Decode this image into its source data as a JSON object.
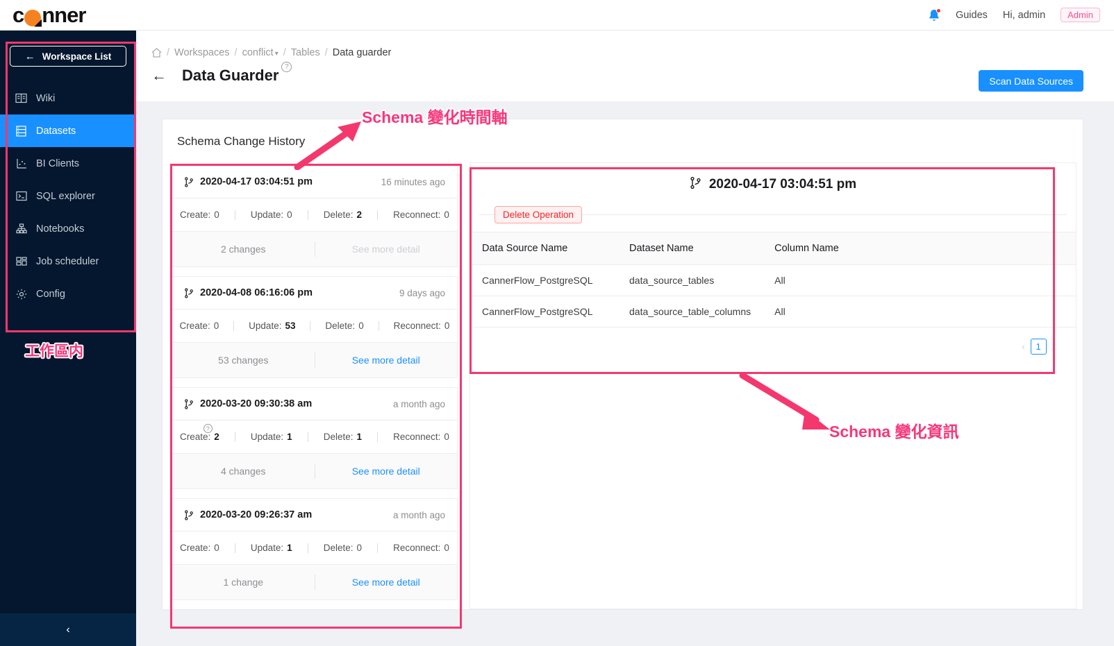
{
  "topbar": {
    "logo_text": "canner",
    "bell_icon": "bell-icon",
    "guides_label": "Guides",
    "greeting": "Hi, admin",
    "role_badge": "Admin"
  },
  "sidebar": {
    "workspace_button": "Workspace List",
    "back_arrow": "←",
    "collapse_arrow": "‹",
    "items": [
      {
        "label": "Wiki",
        "icon": "book-icon",
        "active": false
      },
      {
        "label": "Datasets",
        "icon": "database-icon",
        "active": true
      },
      {
        "label": "BI Clients",
        "icon": "chart-icon",
        "active": false
      },
      {
        "label": "SQL explorer",
        "icon": "console-icon",
        "active": false
      },
      {
        "label": "Notebooks",
        "icon": "cluster-icon",
        "active": false
      },
      {
        "label": "Job scheduler",
        "icon": "schedule-icon",
        "active": false
      },
      {
        "label": "Config",
        "icon": "gear-icon",
        "active": false
      }
    ]
  },
  "breadcrumb": {
    "home_icon": "home-icon",
    "items": [
      "Workspaces",
      "conflict",
      "Tables",
      "Data guarder"
    ],
    "separator": "/",
    "caret": "⌄"
  },
  "header": {
    "back_arrow": "←",
    "title": "Data Guarder",
    "help_icon": "?",
    "scan_button": "Scan Data Sources"
  },
  "section": {
    "title": "Schema Change History"
  },
  "timeline": {
    "branch_icon": "git-branch-icon",
    "entries": [
      {
        "date": "2020-04-17 03:04:51 pm",
        "relative": "16 minutes ago",
        "stats": [
          {
            "label": "Create:",
            "value": "0",
            "bold": false
          },
          {
            "label": "Update:",
            "value": "0",
            "bold": false
          },
          {
            "label": "Delete:",
            "value": "2",
            "bold": true
          },
          {
            "label": "Reconnect:",
            "value": "0",
            "bold": false
          }
        ],
        "changes": "2 changes",
        "more_label": "See more detail",
        "more_disabled": true,
        "has_tooltip": false
      },
      {
        "date": "2020-04-08 06:16:06 pm",
        "relative": "9 days ago",
        "stats": [
          {
            "label": "Create:",
            "value": "0",
            "bold": false
          },
          {
            "label": "Update:",
            "value": "53",
            "bold": true
          },
          {
            "label": "Delete:",
            "value": "0",
            "bold": false
          },
          {
            "label": "Reconnect:",
            "value": "0",
            "bold": false
          }
        ],
        "changes": "53 changes",
        "more_label": "See more detail",
        "more_disabled": false,
        "has_tooltip": false
      },
      {
        "date": "2020-03-20 09:30:38 am",
        "relative": "a month ago",
        "stats": [
          {
            "label": "Create:",
            "value": "2",
            "bold": true
          },
          {
            "label": "Update:",
            "value": "1",
            "bold": true
          },
          {
            "label": "Delete:",
            "value": "1",
            "bold": true
          },
          {
            "label": "Reconnect:",
            "value": "0",
            "bold": false
          }
        ],
        "changes": "4 changes",
        "more_label": "See more detail",
        "more_disabled": false,
        "has_tooltip": true
      },
      {
        "date": "2020-03-20 09:26:37 am",
        "relative": "a month ago",
        "stats": [
          {
            "label": "Create:",
            "value": "0",
            "bold": false
          },
          {
            "label": "Update:",
            "value": "1",
            "bold": true
          },
          {
            "label": "Delete:",
            "value": "0",
            "bold": false
          },
          {
            "label": "Reconnect:",
            "value": "0",
            "bold": false
          }
        ],
        "changes": "1 change",
        "more_label": "See more detail",
        "more_disabled": false,
        "has_tooltip": false
      }
    ]
  },
  "detail": {
    "branch_icon": "git-branch-icon",
    "date": "2020-04-17 03:04:51 pm",
    "operation_badge": "Delete Operation",
    "columns": [
      "Data Source Name",
      "Dataset Name",
      "Column Name"
    ],
    "rows": [
      [
        "CannerFlow_PostgreSQL",
        "data_source_tables",
        "All"
      ],
      [
        "CannerFlow_PostgreSQL",
        "data_source_table_columns",
        "All"
      ]
    ],
    "pagination": {
      "prev": "‹",
      "current": "1",
      "next": "›"
    }
  },
  "annotations": {
    "workspace_label": "工作區内",
    "timeline_label": "Schema 變化時間軸",
    "detail_label": "Schema 變化資訊",
    "color": "#f4386e"
  }
}
